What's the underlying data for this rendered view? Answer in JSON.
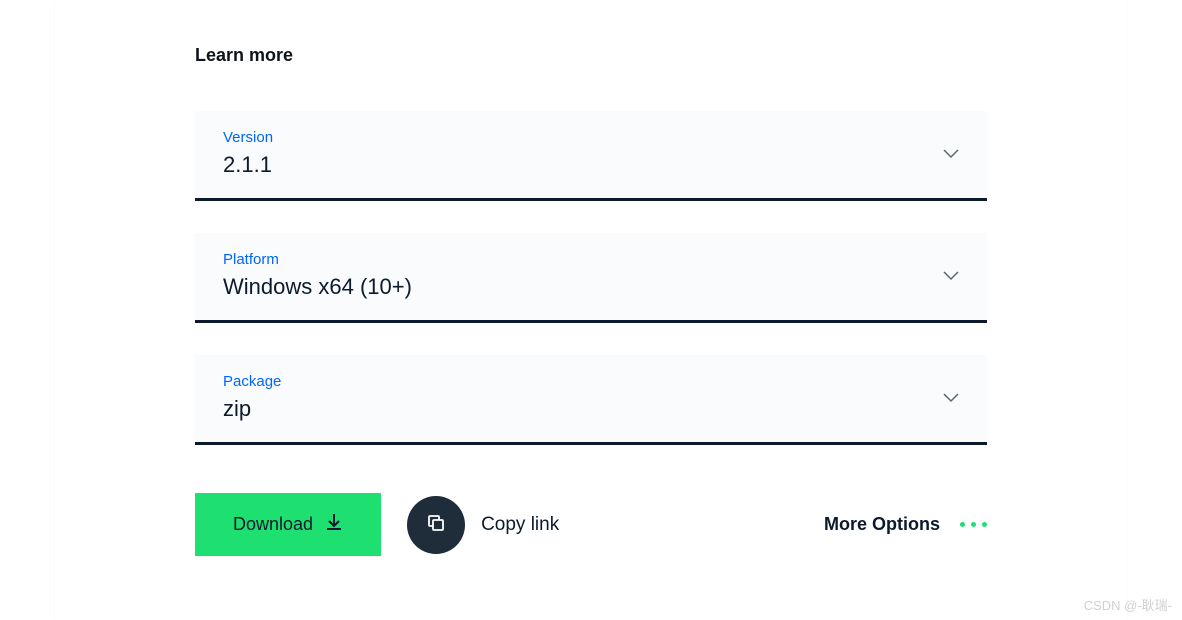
{
  "learn_more": "Learn more",
  "dropdowns": {
    "version": {
      "label": "Version",
      "value": "2.1.1"
    },
    "platform": {
      "label": "Platform",
      "value": "Windows x64 (10+)"
    },
    "package": {
      "label": "Package",
      "value": "zip"
    }
  },
  "actions": {
    "download": "Download",
    "copy_link": "Copy link",
    "more_options": "More Options"
  },
  "watermark": "CSDN @-耿瑞-"
}
